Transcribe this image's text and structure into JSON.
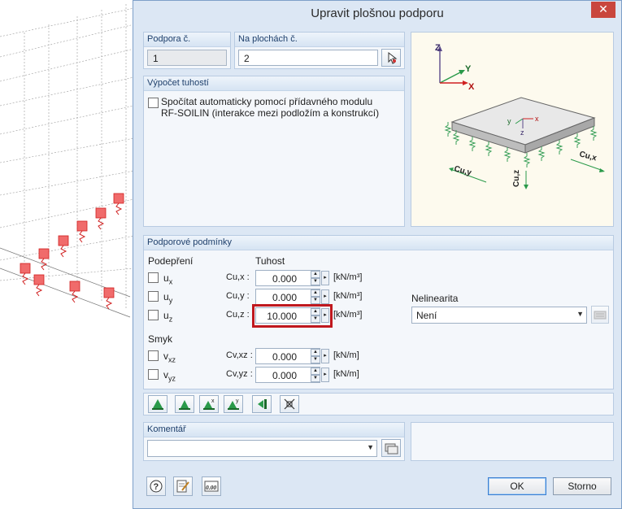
{
  "dialog": {
    "title": "Upravit plošnou podporu",
    "close_label": "✕"
  },
  "support_no": {
    "label": "Podpora č.",
    "value": "1"
  },
  "on_surfaces": {
    "label": "Na plochách č.",
    "value": "2"
  },
  "stiffness_calc": {
    "header": "Výpočet tuhostí",
    "checkbox_line1": "Spočítat automaticky pomocí přídavného modulu",
    "checkbox_line2": "RF-SOILIN (interakce mezi podložím a konstrukcí)"
  },
  "preview": {
    "axis_x": "X",
    "axis_y": "Y",
    "axis_z": "Z",
    "local_x": "x",
    "local_y": "y",
    "local_z": "z",
    "label_cuy": "Cu,y",
    "label_cux": "Cu,x",
    "label_cuz": "Cu,z"
  },
  "conditions": {
    "header": "Podporové podmínky",
    "support_col": "Podepření",
    "stiffness_col": "Tuhost",
    "rows": [
      {
        "dof": "u",
        "sub": "x",
        "coef": "Cu,x :",
        "value": "0.000",
        "unit": "[kN/m³]"
      },
      {
        "dof": "u",
        "sub": "y",
        "coef": "Cu,y :",
        "value": "0.000",
        "unit": "[kN/m³]"
      },
      {
        "dof": "u",
        "sub": "z",
        "coef": "Cu,z :",
        "value": "10.000",
        "unit": "[kN/m³]"
      }
    ],
    "shear_label": "Smyk",
    "shear_rows": [
      {
        "dof": "v",
        "sub": "xz",
        "coef": "Cv,xz :",
        "value": "0.000",
        "unit": "[kN/m]"
      },
      {
        "dof": "v",
        "sub": "yz",
        "coef": "Cv,yz :",
        "value": "0.000",
        "unit": "[kN/m]"
      }
    ],
    "nonlinearity_label": "Nelinearita",
    "nonlinearity_value": "Není"
  },
  "comment": {
    "header": "Komentář",
    "value": ""
  },
  "buttons": {
    "ok": "OK",
    "cancel": "Storno"
  },
  "colors": {
    "accent": "#c0181e",
    "dialog_bg": "#dce7f4",
    "group_header": "#1e3f6b"
  }
}
